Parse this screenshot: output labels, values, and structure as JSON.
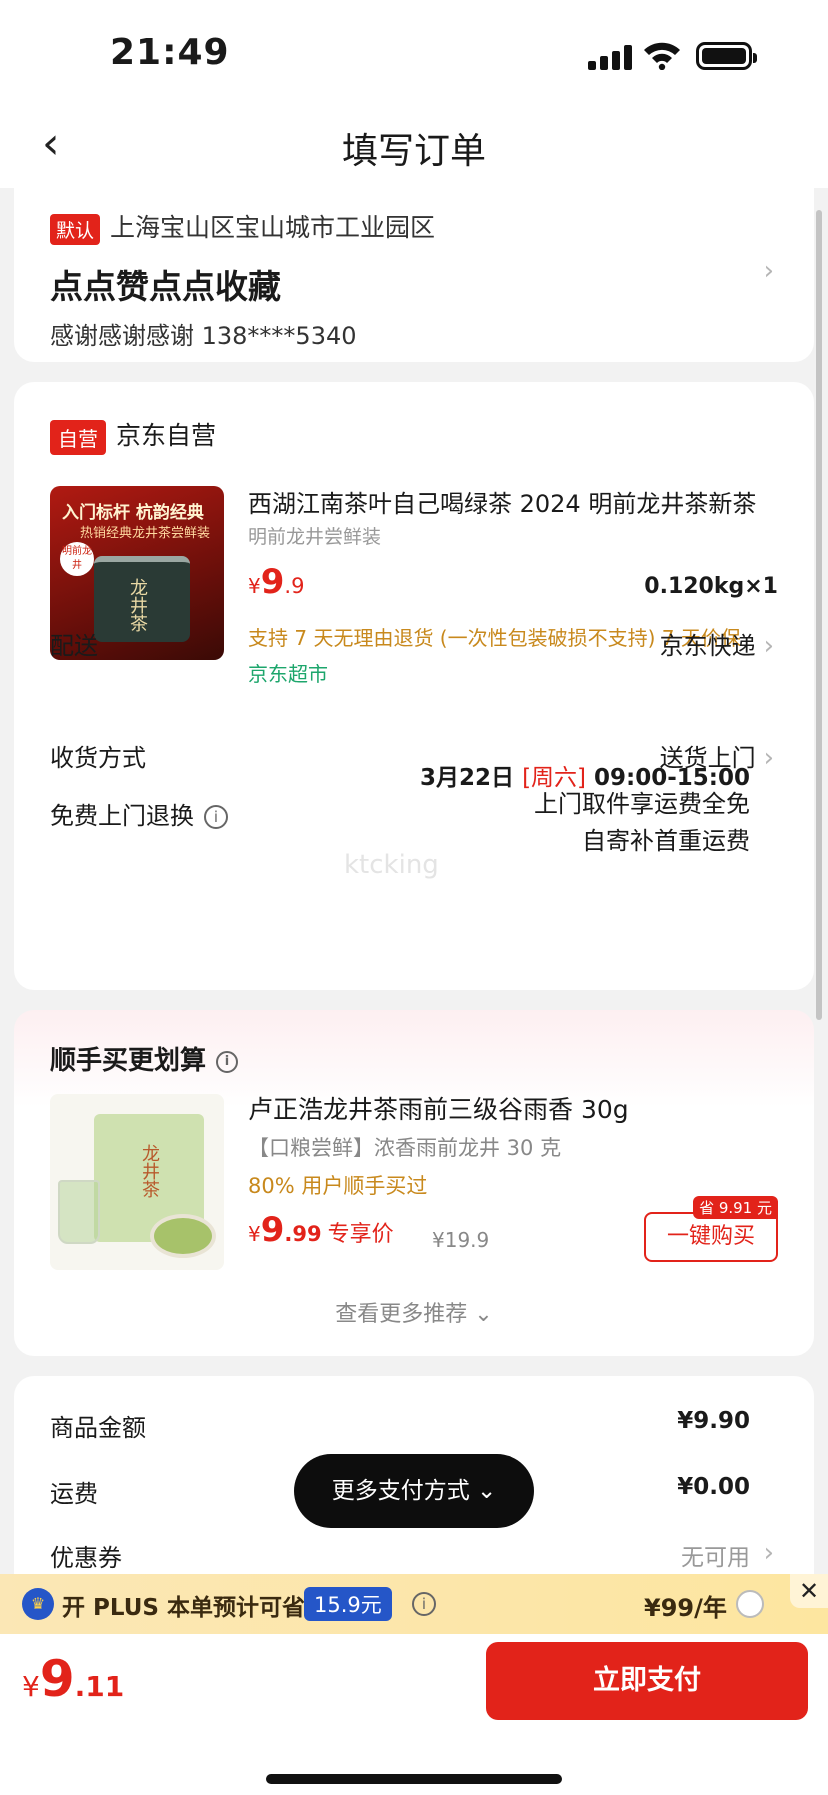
{
  "status": {
    "time": "21:49"
  },
  "nav": {
    "title": "填写订单"
  },
  "address": {
    "tag": "默认",
    "region": "上海宝山区宝山城市工业园区",
    "detail": "点点赞点点收藏",
    "contact": "感谢感谢感谢  138****5340"
  },
  "order": {
    "shop_tag": "自营",
    "shop_name": "京东自营",
    "product": {
      "img_line1": "入门标杆 杭韵经典",
      "img_line2": "热销经典龙井茶尝鲜装",
      "img_badge": "明前龙井",
      "img_can": "龙井茶",
      "name": "西湖江南茶叶自己喝绿茶 2024 明前龙井茶新茶",
      "spec": "明前龙井尝鲜装",
      "price_cur": "¥",
      "price_int": "9",
      "price_dec": ".9",
      "qty": "0.120kg×1",
      "support": "支持 7 天无理由退货 (一次性包装破损不支持)  7 天价保",
      "channel": "京东超市"
    },
    "delivery": {
      "label": "配送",
      "value": "京东快递",
      "date": "3月22日",
      "weekday": "[周六]",
      "window": "09:00-15:00"
    },
    "receive": {
      "label": "收货方式",
      "value": "送货上门"
    },
    "return": {
      "label": "免费上门退换",
      "value_line1": "上门取件享运费全免",
      "value_line2": "自寄补首重运费"
    },
    "watermark": "ktcking"
  },
  "recommend": {
    "title": "顺手买更划算",
    "item": {
      "img_label": "龙井茶",
      "name": "卢正浩龙井茶雨前三级谷雨香 30g",
      "sub": "【口粮尝鲜】浓香雨前龙井 30 克",
      "bought": "80% 用户顺手买过",
      "price_cur": "¥",
      "price_int": "9",
      "price_dec": ".99",
      "exclusive": "专享价",
      "orig_price": "¥19.9",
      "save_badge": "省 9.91 元",
      "buy_label": "一键购买"
    },
    "more": "查看更多推荐 ⌄"
  },
  "summary": {
    "goods_label": "商品金额",
    "goods_value": "¥9.90",
    "ship_label": "运费",
    "ship_value": "¥0.00",
    "coupon_label": "优惠券",
    "coupon_value": "无可用"
  },
  "float_pay": "更多支付方式 ⌄",
  "plus": {
    "text": "开 PLUS 本单预计可省",
    "save": "15.9元",
    "price": "¥99/年"
  },
  "bottom": {
    "total_cur": "¥",
    "total_int": "9",
    "total_dec": ".11",
    "pay_label": "立即支付"
  }
}
